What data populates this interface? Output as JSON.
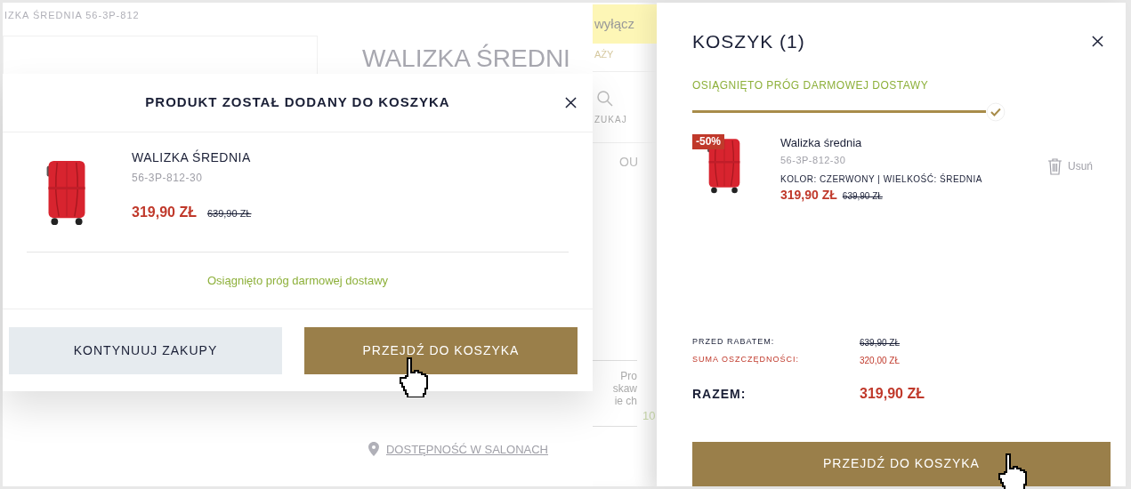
{
  "background_page": {
    "breadcrumb": "IZKA ŚREDNIA 56-3P-812",
    "product_title": "WALIZKA ŚREDNI",
    "store_link": "DOSTĘPNOŚĆ W SALONACH"
  },
  "side_strip": {
    "banner": "wyłącz",
    "nav_text": "AŻY",
    "search_label": "ZUKAJ",
    "tab_text": "OU",
    "text_lines": [
      "Pro",
      "skaw",
      "ie ch"
    ],
    "number": "10"
  },
  "modal": {
    "title": "PRODUKT ZOSTAŁ DODANY DO KOSZYKA",
    "item": {
      "name": "WALIZKA ŚREDNIA",
      "code": "56-3P-812-30",
      "price": "319,90 ZŁ",
      "old_price": "639,90 ZŁ"
    },
    "free_shipping": "Osiągnięto próg darmowej dostawy",
    "buttons": [
      {
        "label": "KONTYNUUJ ZAKUPY",
        "kind": "secondary"
      },
      {
        "label": "PRZEJDŹ DO KOSZYKA",
        "kind": "primary"
      }
    ]
  },
  "cart_drawer": {
    "title": "KOSZYK (1)",
    "free_shipping": {
      "label": "OSIĄGNIĘTO PRÓG DARMOWEJ DOSTAWY"
    },
    "items": [
      {
        "name": "Walizka średnia",
        "code": "56-3P-812-30",
        "badge": "-50%",
        "attributes": "KOLOR: CZERWONY | WIELKOŚĆ: ŚREDNIA",
        "price": "319,90 ZŁ",
        "old_price": "639,90 ZŁ",
        "remove_label": "Usuń"
      }
    ],
    "summary": [
      {
        "label": "PRZED RABATEM:",
        "value": "639,90 ZŁ",
        "kind": "before_discount"
      },
      {
        "label": "SUMA OSZCZĘDNOŚCI:",
        "value": "320,00 ZŁ",
        "kind": "savings"
      }
    ],
    "total": {
      "label": "RAZEM:",
      "value": "319,90 ZŁ"
    },
    "checkout_button": "PRZEJDŹ DO KOSZYKA"
  }
}
